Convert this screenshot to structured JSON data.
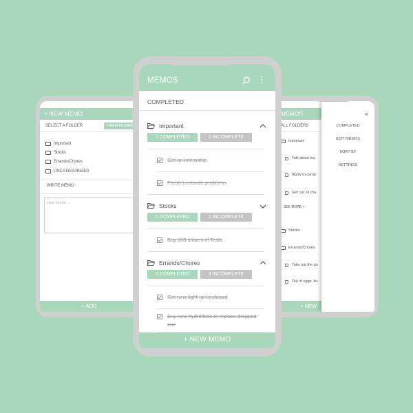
{
  "left_screen": {
    "header_title": "< NEW MEMO",
    "kebab": "⋮",
    "select_folder_label": "SELECT A FOLDER",
    "new_folder_button": "+ NEW FOLDER",
    "folders": [
      "Important",
      "Stocks",
      "Errands/Chores",
      "UNCATEGORIZED"
    ],
    "write_memo_label": "WRITE MEMO",
    "memo_placeholder": "new memo ...",
    "add_button": "+ ADD"
  },
  "center_screen": {
    "title": "MEMOS",
    "section_label": "COMPLETED",
    "folders": [
      {
        "name": "Important",
        "completed_badge": "1 COMPLETED",
        "incomplete_badge": "2 INCOMPLETE",
        "expanded": true,
        "memos": [
          "Get an internship",
          "Finish Leetcode problems"
        ]
      },
      {
        "name": "Stocks",
        "completed_badge": "1 COMPLETED",
        "incomplete_badge": "2 INCOMPLETE",
        "expanded": false,
        "memos": [
          "Buy 100 shares of Tesla"
        ]
      },
      {
        "name": "Errands/Chores",
        "completed_badge": "5 COMPLETED",
        "incomplete_badge": "3 INCOMPLETE",
        "expanded": true,
        "memos": [
          "Get new light-up keyboard",
          "Buy new hydroflask to replace dropped one"
        ]
      }
    ],
    "new_memo_button": "+ NEW MEMO"
  },
  "right_screen": {
    "header_title": "MEMOS",
    "all_folders_label": "ALL FOLDERS",
    "folder_important": "Important",
    "items_important": [
      "Talk about lea",
      "Apply to camp",
      "Get car oil cha"
    ],
    "see_more": "SEE MORE  >",
    "folder_stocks": "Stocks",
    "folder_errands": "Errands/Chores",
    "items_errands": [
      "Take out the ga",
      "Out of eggs, bu"
    ],
    "bottom_button": "+ NEW",
    "menu_close": "×",
    "menu_items": [
      "COMPLETED",
      "EDIT MEMOS",
      "SORT BY",
      "SETTINGS"
    ]
  },
  "colors": {
    "accent": "#a9d7bb",
    "badge_grey": "#c4c4c4",
    "bezel": "#d0d0d0"
  }
}
